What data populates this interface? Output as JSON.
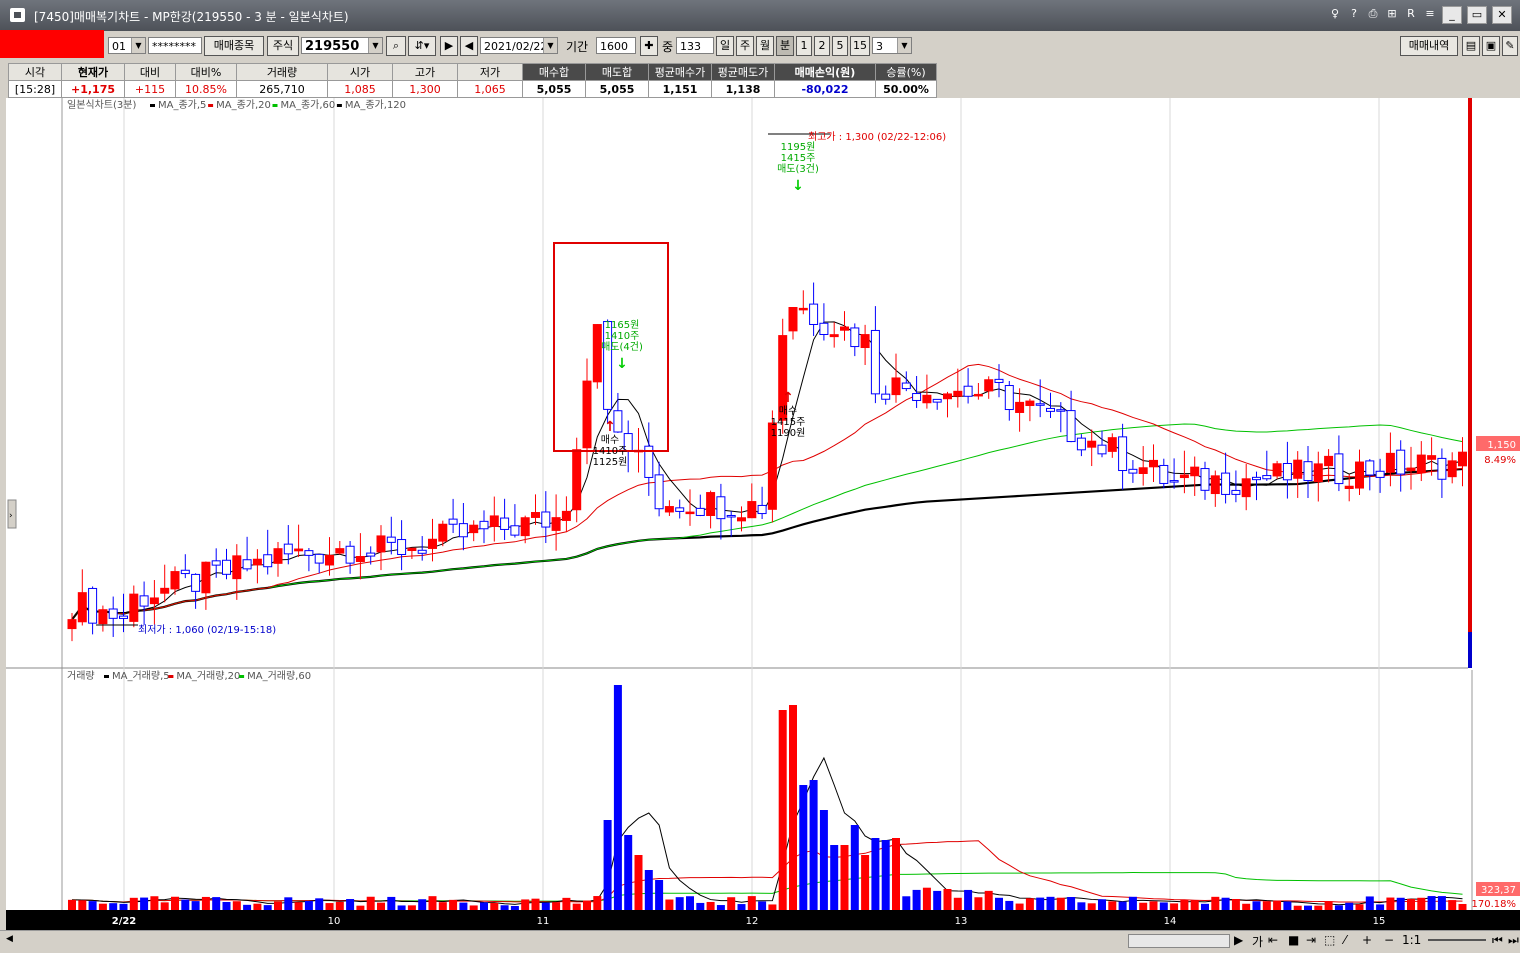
{
  "window": {
    "title": "[7450]매매복기차트 - MP한강(219550 - 3 분 - 일본식차트)"
  },
  "titlebar_icons": [
    "question-icon",
    "help-icon",
    "print-icon",
    "layout-icon",
    "R",
    "settings-icon",
    "minimize-icon",
    "maximize-icon",
    "close-icon"
  ],
  "toolbar": {
    "account_no": "01",
    "password": "********",
    "trade_stock_btn": "매매종목",
    "market_label": "주식",
    "code": "219550",
    "date": "2021/02/22",
    "period_label": "기간",
    "period": "1600",
    "mid_label": "중",
    "mid_value": "133",
    "tf_day": "일",
    "tf_week": "주",
    "tf_month": "월",
    "tf_min": "분",
    "min_1": "1",
    "min_2": "2",
    "min_5": "5",
    "min_15": "15",
    "min_sel": "3",
    "history_btn": "매매내역"
  },
  "info": {
    "headers": [
      "시각",
      "현재가",
      "대비",
      "대비%",
      "거래량",
      "시가",
      "고가",
      "저가",
      "매수합",
      "매도합",
      "평균매수가",
      "평균매도가",
      "매매손익(원)",
      "승률(%)"
    ],
    "values": [
      "[15:28]",
      "+1,175",
      "+115",
      "10.85%",
      "265,710",
      "1,085",
      "1,300",
      "1,065",
      "5,055",
      "5,055",
      "1,151",
      "1,138",
      "-80,022",
      "50.00%"
    ]
  },
  "price_chart": {
    "legend_title": "일본식차트(3분)",
    "legend_items": [
      {
        "label": "MA_종가,5",
        "color": "#000000"
      },
      {
        "label": "MA_종가,20",
        "color": "#e00000"
      },
      {
        "label": "MA_종가,60",
        "color": "#00c000"
      },
      {
        "label": "MA_종가,120",
        "color": "#000000"
      }
    ],
    "high_label": "최고가 : 1,300 (02/22-12:06)",
    "low_label": "최저가 : 1,060 (02/19-15:18)",
    "sell1": [
      "1165원",
      "1410주",
      "매도(4건)"
    ],
    "buy1": [
      "매수",
      "1410주",
      "1125원"
    ],
    "sell2": [
      "1195원",
      "1415주",
      "매도(3건)"
    ],
    "buy2": [
      "매수",
      "1415주",
      "1190원"
    ],
    "right_price": "1,150",
    "right_pct": "8.49%"
  },
  "volume_chart": {
    "legend_title": "거래량",
    "legend_items": [
      {
        "label": "MA_거래량,5",
        "color": "#000000"
      },
      {
        "label": "MA_거래량,20",
        "color": "#e00000"
      },
      {
        "label": "MA_거래량,60",
        "color": "#00c000"
      }
    ],
    "right_vol": "323,37",
    "right_pct": "170.18%"
  },
  "x_axis": [
    "2/22",
    "10",
    "11",
    "12",
    "13",
    "14",
    "15"
  ],
  "bottom": {
    "zoom_label": "1:1",
    "tool_label": "가"
  },
  "colors": {
    "up": "#ff0000",
    "down": "#0000ff",
    "ma5": "#000000",
    "ma20": "#e00000",
    "ma60": "#00c000",
    "ma120": "#000000"
  }
}
